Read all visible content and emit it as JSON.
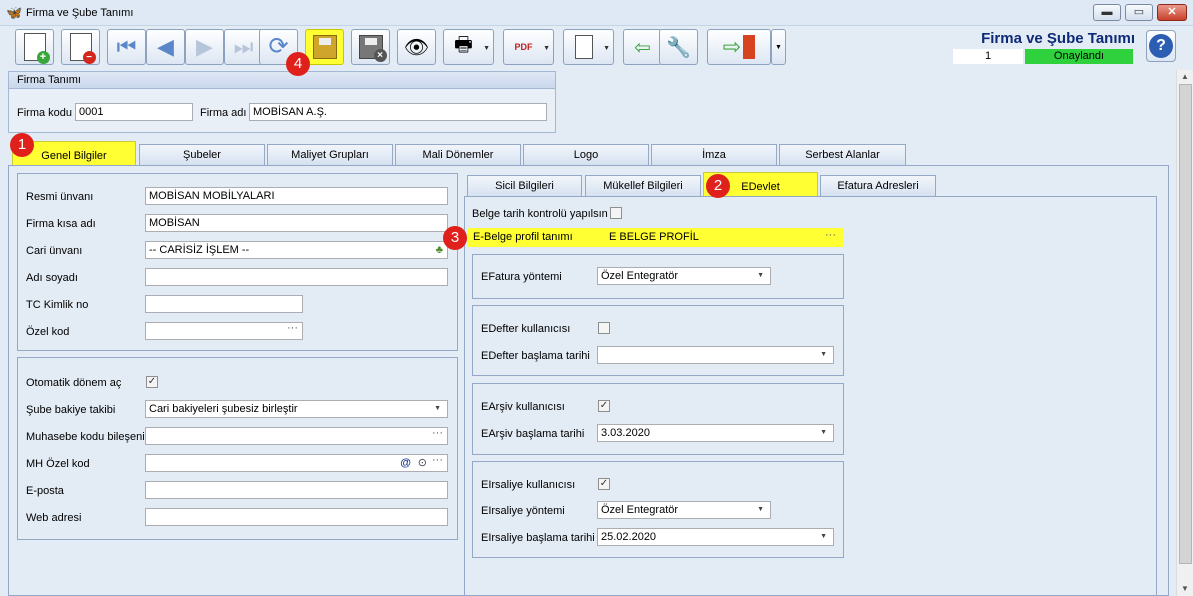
{
  "window": {
    "title": "Firma ve Şube Tanımı",
    "min": "▬",
    "max": "▭",
    "close": "✕"
  },
  "header": {
    "title": "Firma ve Şube Tanımı",
    "record_no": "1",
    "status": "Onaylandı",
    "help_glyph": "?"
  },
  "firma": {
    "caption": "Firma Tanımı",
    "kod_label": "Firma kodu",
    "kod_value": "0001",
    "ad_label": "Firma adı",
    "ad_value": "MOBİSAN A.Ş."
  },
  "tabs": [
    "Genel Bilgiler",
    "Şubeler",
    "Maliyet Grupları",
    "Mali Dönemler",
    "Logo",
    "İmza",
    "Serbest Alanlar"
  ],
  "left": {
    "resmi_label": "Resmi ünvanı",
    "resmi_value": "MOBİSAN MOBİLYALARI",
    "kisa_label": "Firma kısa adı",
    "kisa_value": "MOBİSAN",
    "cari_label": "Cari ünvanı",
    "cari_value": "-- CARİSİZ İŞLEM --",
    "adsoyad_label": "Adı soyadı",
    "tc_label": "TC Kimlik no",
    "ozel_label": "Özel kod",
    "otodonem_label": "Otomatik dönem aç",
    "sube_label": "Şube bakiye takibi",
    "sube_value": "Cari bakiyeleri şubesiz birleştir",
    "muh_label": "Muhasebe kodu bileşeni",
    "mh_label": "MH Özel kod",
    "eposta_label": "E-posta",
    "web_label": "Web adresi"
  },
  "subtabs": [
    "Sicil Bilgileri",
    "Mükellef Bilgileri",
    "EDevlet",
    "Efatura Adresleri"
  ],
  "edevlet": {
    "belge_tarih_label": "Belge tarih kontrolü yapılsın",
    "ebelge_label": "E-Belge profil tanımı",
    "ebelge_value": "E BELGE PROFİL",
    "efatura_yontem_label": "EFatura yöntemi",
    "efatura_yontem_value": "Özel Entegratör",
    "edefter_label": "EDefter kullanıcısı",
    "edefter_tarih_label": "EDefter başlama tarihi",
    "earsiv_label": "EArşiv kullanıcısı",
    "earsiv_tarih_label": "EArşiv başlama tarihi",
    "earsiv_tarih_value": "3.03.2020",
    "eirsaliye_label": "EIrsaliye kullanıcısı",
    "eirsaliye_yontem_label": "EIrsaliye yöntemi",
    "eirsaliye_yontem_value": "Özel Entegratör",
    "eirsaliye_tarih_label": "EIrsaliye başlama tarihi",
    "eirsaliye_tarih_value": "25.02.2020"
  },
  "markers": [
    "1",
    "2",
    "3",
    "4"
  ],
  "glyphs": {
    "ellipsis": "···",
    "dropdown": "▼",
    "check": "✓",
    "at": "@",
    "minus": "−",
    "plus": "+"
  }
}
